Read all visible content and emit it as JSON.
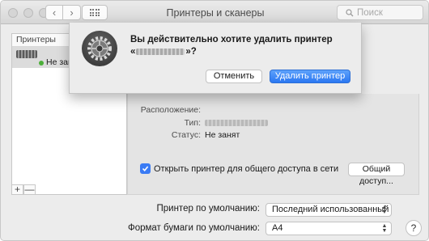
{
  "window": {
    "title": "Принтеры и сканеры",
    "search_placeholder": "Поиск"
  },
  "sidebar": {
    "header": "Принтеры",
    "printers": [
      {
        "status": "Не занят"
      }
    ],
    "add_label": "+",
    "remove_label": "—"
  },
  "details": {
    "location_label": "Расположение:",
    "type_label": "Тип:",
    "status_label": "Статус:",
    "status_value": "Не занят",
    "share_label": "Открыть принтер для общего доступа в сети",
    "share_checked": true,
    "share_button": "Общий доступ..."
  },
  "defaults": {
    "printer_label": "Принтер по умолчанию:",
    "printer_value": "Последний использованный",
    "paper_label": "Формат бумаги по умолчанию:",
    "paper_value": "A4",
    "help_label": "?"
  },
  "dialog": {
    "line1": "Вы действительно хотите удалить принтер",
    "line2_prefix": "«",
    "line2_suffix": "»?",
    "cancel_label": "Отменить",
    "delete_label": "Удалить принтер"
  },
  "colors": {
    "accent": "#2a77f2",
    "status_idle": "#4caf3a"
  }
}
